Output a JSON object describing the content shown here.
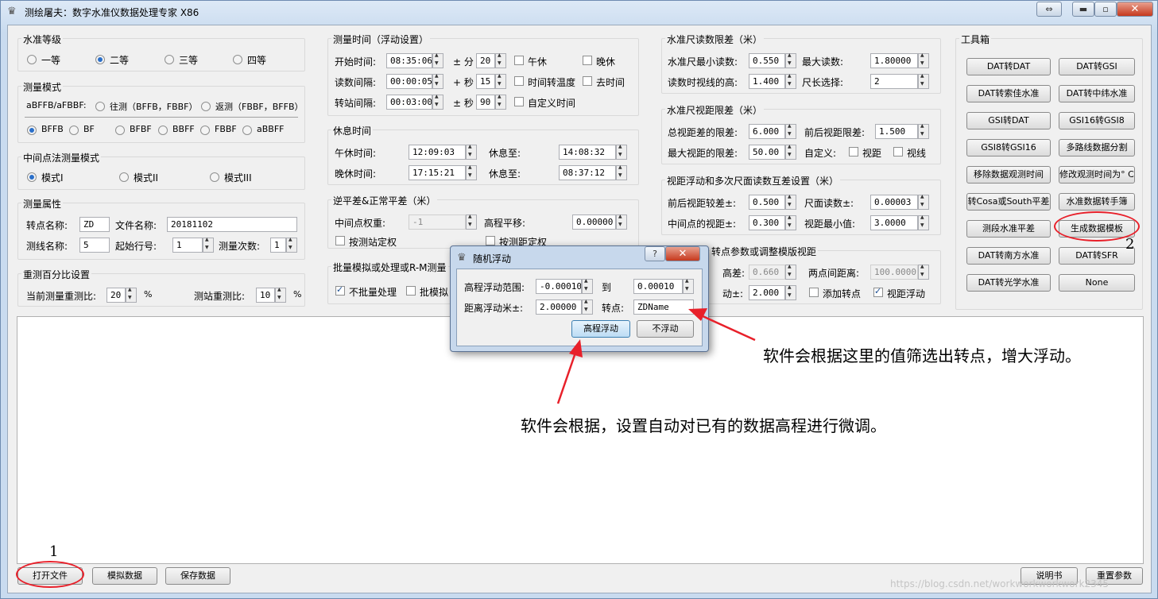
{
  "window": {
    "title": "测绘屠夫：数字水准仪数据处理专家 X86",
    "ctrl_swap": "⇔",
    "ctrl_min": "▬",
    "ctrl_max": "▫",
    "ctrl_close": "✕"
  },
  "level": {
    "title": "水准等级",
    "options": [
      "一等",
      "二等",
      "三等",
      "四等"
    ],
    "selected": 1
  },
  "mode": {
    "title": "测量模式",
    "prefix": "aBFFB/aFBBF:",
    "forward": "往测（BFFB，FBBF）",
    "backward": "返测（FBBF，BFFB）",
    "orders": [
      "BFFB",
      "BF",
      "BFBF",
      "BBFF",
      "FBBF",
      "aBBFF"
    ],
    "selected_order": 0
  },
  "mid": {
    "title": "中间点法测量模式",
    "options": [
      "模式I",
      "模式II",
      "模式III"
    ],
    "selected": 0
  },
  "attr": {
    "title": "测量属性",
    "turn_label": "转点名称:",
    "turn_value": "ZD",
    "file_label": "文件名称:",
    "file_value": "20181102",
    "line_label": "测线名称:",
    "line_value": "5",
    "start_label": "起始行号:",
    "start_value": "1",
    "count_label": "测量次数:",
    "count_value": "1"
  },
  "repeat": {
    "title": "重测百分比设置",
    "current_label": "当前测量重测比:",
    "current_value": "20",
    "pct": "%",
    "station_label": "测站重测比:",
    "station_value": "10"
  },
  "time": {
    "title": "测量时间（浮动设置）",
    "start_label": "开始时间:",
    "start_value": "08:35:06",
    "pm_min": "± 分",
    "min_value": "20",
    "noon": "午休",
    "evening": "晚休",
    "read_label": "读数间隔:",
    "read_value": "00:00:05",
    "plus_sec": "+ 秒",
    "sec_value": "15",
    "temp": "时间转温度",
    "remove": "去时间",
    "turn_label": "转站间隔:",
    "turn_value": "00:03:00",
    "pm_sec": "± 秒",
    "sec2_value": "90",
    "custom": "自定义时间"
  },
  "rest": {
    "title": "休息时间",
    "noon_label": "午休时间:",
    "noon_value": "12:09:03",
    "noon_to_label": "休息至:",
    "noon_to_value": "14:08:32",
    "eve_label": "晚休时间:",
    "eve_value": "17:15:21",
    "eve_to_label": "休息至:",
    "eve_to_value": "08:37:12"
  },
  "adj": {
    "title": "逆平差&正常平差（米）",
    "weight_label": "中间点权重:",
    "weight_value": "-1",
    "shift_label": "高程平移:",
    "shift_value": "0.00000",
    "by_station": "按测站定权",
    "by_distance": "按测距定权"
  },
  "batch": {
    "title": "批量模拟或处理或R-M测量",
    "no_batch": "不批量处理",
    "batch_sim": "批模拟"
  },
  "staff": {
    "title": "水准尺读数限差（米）",
    "min_label": "水准尺最小读数:",
    "min_value": "0.550",
    "max_label": "最大读数:",
    "max_value": "1.80000",
    "height_label": "读数时视线的高:",
    "height_value": "1.400",
    "len_label": "尺长选择:",
    "len_value": "2"
  },
  "dist": {
    "title": "水准尺视距限差（米）",
    "total_label": "总视距差的限差:",
    "total_value": "6.000",
    "fb_label": "前后视距限差:",
    "fb_value": "1.500",
    "max_label": "最大视距的限差:",
    "max_value": "50.00",
    "custom_label": "自定义:",
    "sight": "视距",
    "line": "视线"
  },
  "float": {
    "title": "视距浮动和多次尺面读数互差设置（米）",
    "fb_label": "前后视距较差±:",
    "fb_value": "0.500",
    "face_label": "尺面读数±:",
    "face_value": "0.00003",
    "mid_label": "中间点的视距±:",
    "mid_value": "0.300",
    "min_label": "视距最小值:",
    "min_value": "3.0000"
  },
  "tpl": {
    "title": "转点参数或调整模版视距",
    "h_label": "高差:",
    "h_value": "0.660",
    "two_label": "两点间距离:",
    "two_value": "100.0000",
    "f_label": "动±:",
    "f_value": "2.000",
    "add": "添加转点",
    "sf": "视距浮动"
  },
  "tools": {
    "title": "工具箱",
    "buttons": [
      "DAT转DAT",
      "DAT转GSI",
      "DAT转索佳水准",
      "DAT转中纬水准",
      "GSI转DAT",
      "GSI16转GSI8",
      "GSI8转GSI16",
      "多路线数据分割",
      "移除数据观测时间",
      "修改观测时间为° C",
      "转Cosa或South平差",
      "水准数据转手簿",
      "测段水准平差",
      "生成数据模板",
      "DAT转南方水准",
      "DAT转SFR",
      "DAT转光学水准",
      "None"
    ]
  },
  "bottom": {
    "open": "打开文件",
    "simulate": "模拟数据",
    "save": "保存数据",
    "help": "说明书",
    "reset": "重置参数"
  },
  "dialog": {
    "title": "随机浮动",
    "help": "?",
    "close": "✕",
    "range_label": "高程浮动范围:",
    "range_from": "-0.00010",
    "to": "到",
    "range_to": "0.00010",
    "dist_label": "距离浮动米±:",
    "dist_value": "2.00000",
    "turn_label": "转点:",
    "turn_value": "ZDName",
    "ok": "高程浮动",
    "cancel": "不浮动"
  },
  "annotations": {
    "right": "软件会根据这里的值筛选出转点，增大浮动。",
    "bottom": "软件会根据，设置自动对已有的数据高程进行微调。",
    "n1": "1",
    "n2": "2",
    "color": "#e8202a"
  },
  "watermark": "https://blog.csdn.net/workworkworkwork2345"
}
